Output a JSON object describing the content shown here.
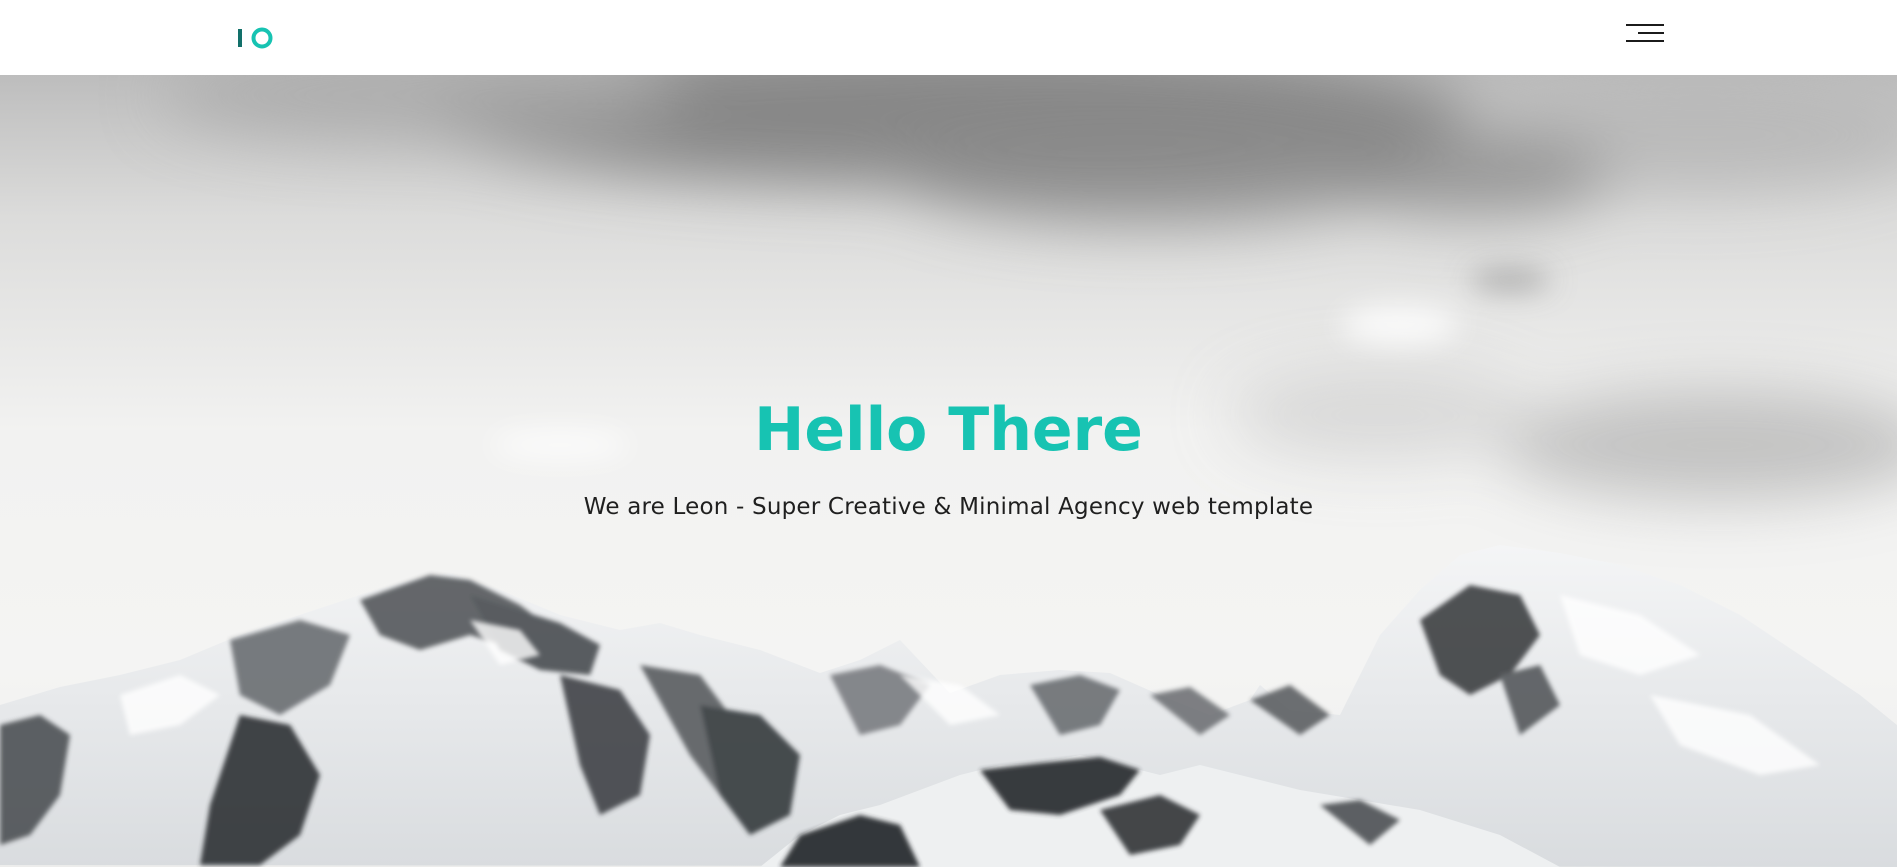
{
  "header": {
    "logo_icon": "io-logo-icon",
    "menu_icon": "hamburger-menu-icon"
  },
  "hero": {
    "title": "Hello There",
    "subtitle": "We are Leon - Super Creative & Minimal Agency web template",
    "background_icon": "snowy-mountains-image"
  },
  "colors": {
    "accent": "#17c3b2",
    "logo_dark": "#12706a",
    "text": "#1f1f1f",
    "menu": "#1b1b1b"
  }
}
